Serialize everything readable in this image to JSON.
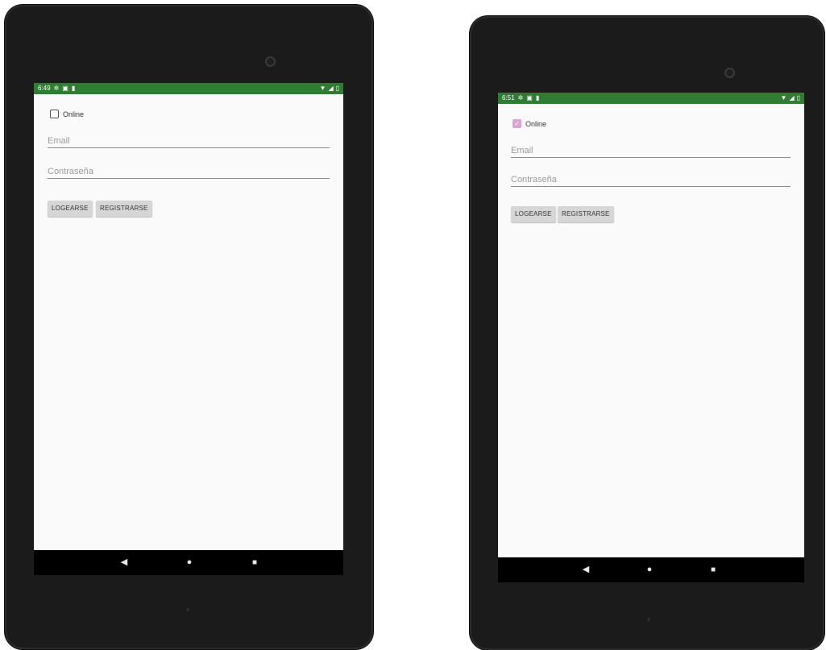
{
  "devices": [
    {
      "status_bar": {
        "time": "6:49",
        "color": "#2e7d32"
      },
      "form": {
        "online_label": "Online",
        "online_checked": false,
        "email_placeholder": "Email",
        "password_placeholder": "Contraseña",
        "login_button": "LOGEARSE",
        "register_button": "REGISTRARSE"
      }
    },
    {
      "status_bar": {
        "time": "6:51",
        "color": "#2e7d32"
      },
      "form": {
        "online_label": "Online",
        "online_checked": true,
        "checkbox_color": "#d9a6d1",
        "email_placeholder": "Email",
        "password_placeholder": "Contraseña",
        "login_button": "LOGEARSE",
        "register_button": "REGISTRARSE"
      }
    }
  ],
  "icons": {
    "status_left": [
      "gear-icon",
      "sim-icon",
      "sd-card-icon"
    ],
    "status_right": [
      "wifi-icon",
      "signal-icon",
      "battery-icon"
    ],
    "nav": [
      "back-icon",
      "home-icon",
      "recents-icon"
    ]
  }
}
